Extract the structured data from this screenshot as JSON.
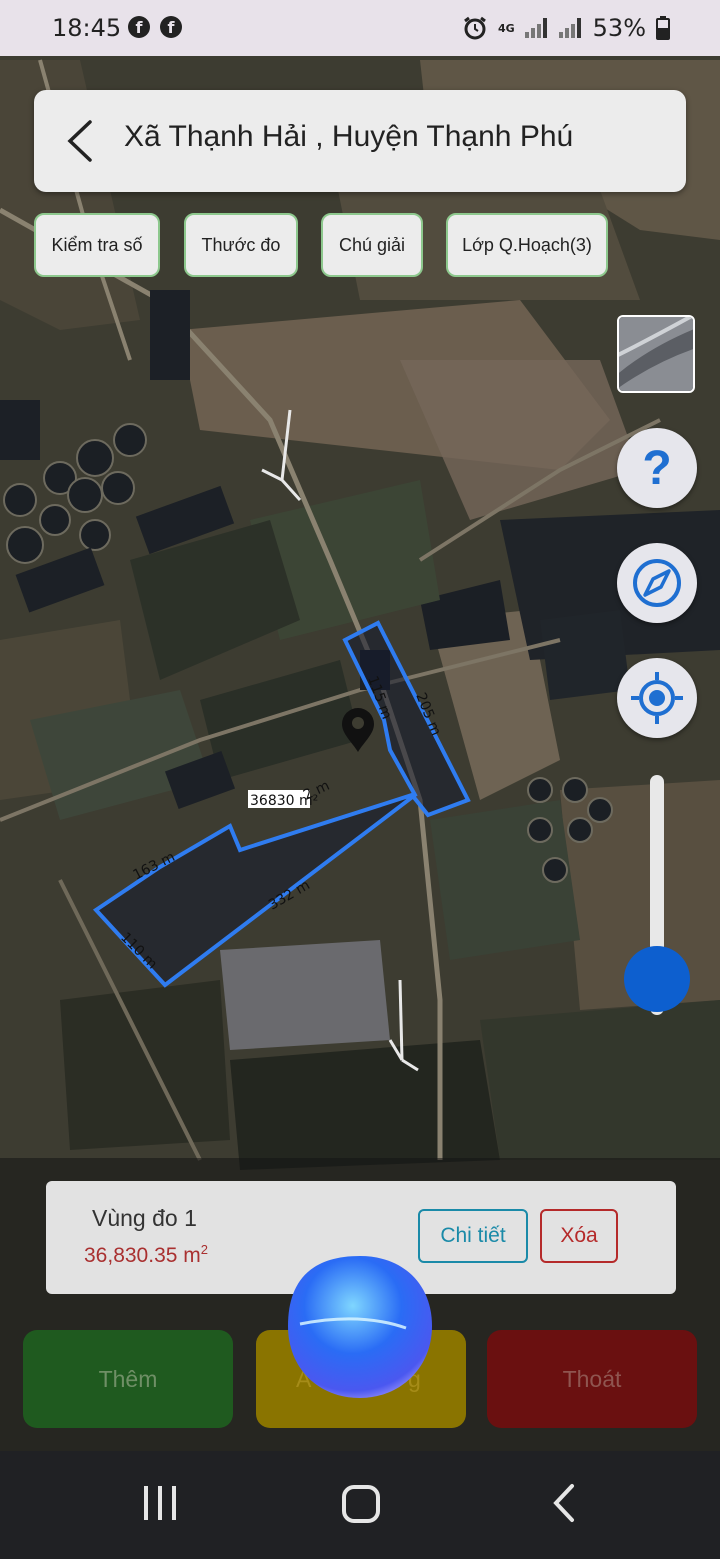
{
  "status_bar": {
    "time": "18:45",
    "notification_icons": [
      "facebook-icon",
      "facebook-icon"
    ],
    "system_icons": [
      "alarm-icon",
      "4g-signal-icon",
      "signal-icon",
      "signal-icon",
      "battery-icon"
    ],
    "network": "4G",
    "battery": "53%"
  },
  "header": {
    "title": "Xã Thạnh Hải , Huyện Thạnh Phú"
  },
  "toolbar": {
    "buttons": [
      {
        "label": "Kiểm tra số"
      },
      {
        "label": "Thước đo"
      },
      {
        "label": "Chú giải"
      },
      {
        "label": "Lớp Q.Hoạch(3)"
      }
    ]
  },
  "map": {
    "measurements": [
      "115 m",
      "205 m",
      "36830 m²",
      "2 m",
      "163 m",
      "332 m",
      "110 m"
    ],
    "accent_color": "#2f7cf0",
    "marker_icon": "map-pin-icon"
  },
  "side_controls": {
    "layer_thumbnail_icon": "map-layer-icon",
    "help_icon": "help-icon",
    "compass_icon": "compass-icon",
    "locate_icon": "my-location-icon",
    "zoom_level": 0.15
  },
  "measure_card": {
    "name": "Vùng đo 1",
    "area_value": "36,830.35 m",
    "area_unit_exp": "2",
    "detail_label": "Chi tiết",
    "delete_label": "Xóa"
  },
  "bottom_buttons": {
    "add_label": "Thêm",
    "middle_label_visible_fragments": [
      "A",
      "g"
    ],
    "exit_label": "Thoát"
  },
  "colors": {
    "add": "#1f5a1f",
    "middle": "#8a7400",
    "exit": "#6a1010",
    "slider": "#0d5fcf"
  }
}
